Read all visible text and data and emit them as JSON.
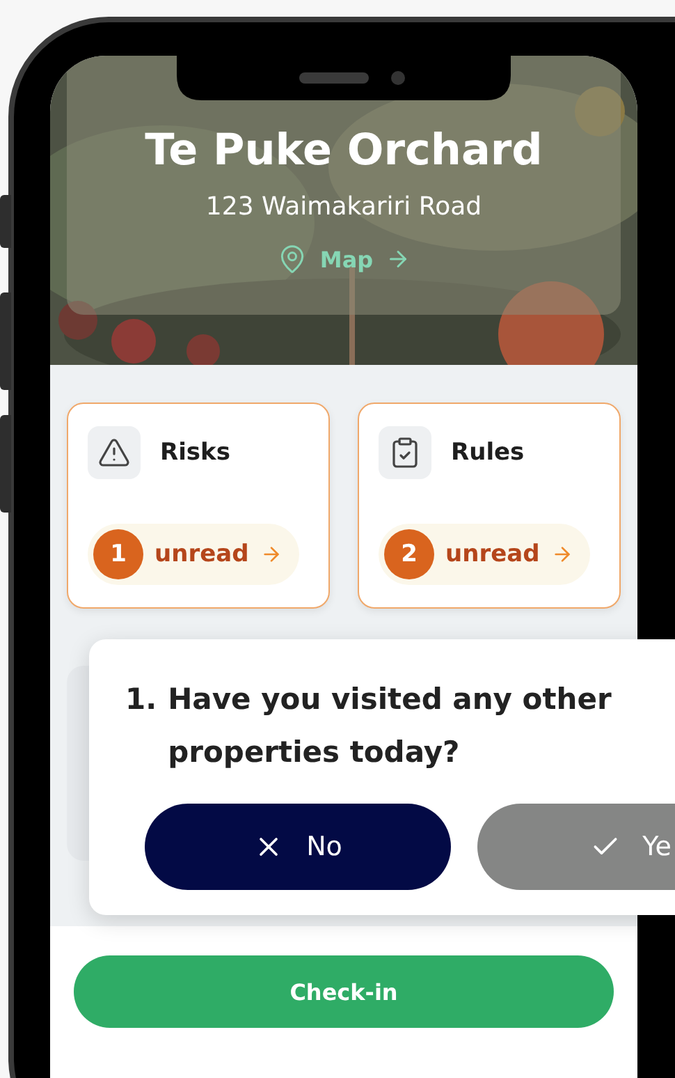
{
  "place": {
    "name": "Te Puke Orchard",
    "address": "123 Waimakariri Road",
    "map_link": "Map"
  },
  "cards": [
    {
      "kind": "risks",
      "title": "Risks",
      "count": "1",
      "status": "unread"
    },
    {
      "kind": "rules",
      "title": "Rules",
      "count": "2",
      "status": "unread"
    }
  ],
  "question": {
    "number": "1.",
    "text": "Have you visited any other properties today?",
    "answers": [
      {
        "kind": "no",
        "label": "No",
        "selected": true
      },
      {
        "kind": "yes",
        "label": "Ye",
        "selected": false
      }
    ]
  },
  "primary_button": "Check-in"
}
